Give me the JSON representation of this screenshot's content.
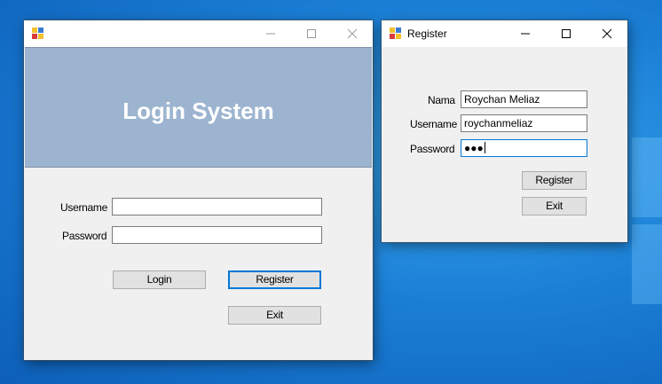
{
  "login_window": {
    "title": "",
    "header_title": "Login System",
    "username_label": "Username",
    "password_label": "Password",
    "username_value": "",
    "password_value": "",
    "login_button": "Login",
    "register_button": "Register",
    "exit_button": "Exit"
  },
  "register_window": {
    "title": "Register",
    "nama_label": "Nama",
    "username_label": "Username",
    "password_label": "Password",
    "nama_value": "Roychan Meliaz",
    "username_value": "roychanmeliaz",
    "password_value": "●●●",
    "register_button": "Register",
    "exit_button": "Exit"
  },
  "colors": {
    "banner": "#9cb4d0",
    "focus_border": "#0078d7",
    "desktop": "#1b7fd6"
  },
  "icons": [
    "app-icon",
    "minimize-icon",
    "maximize-icon",
    "close-icon"
  ]
}
